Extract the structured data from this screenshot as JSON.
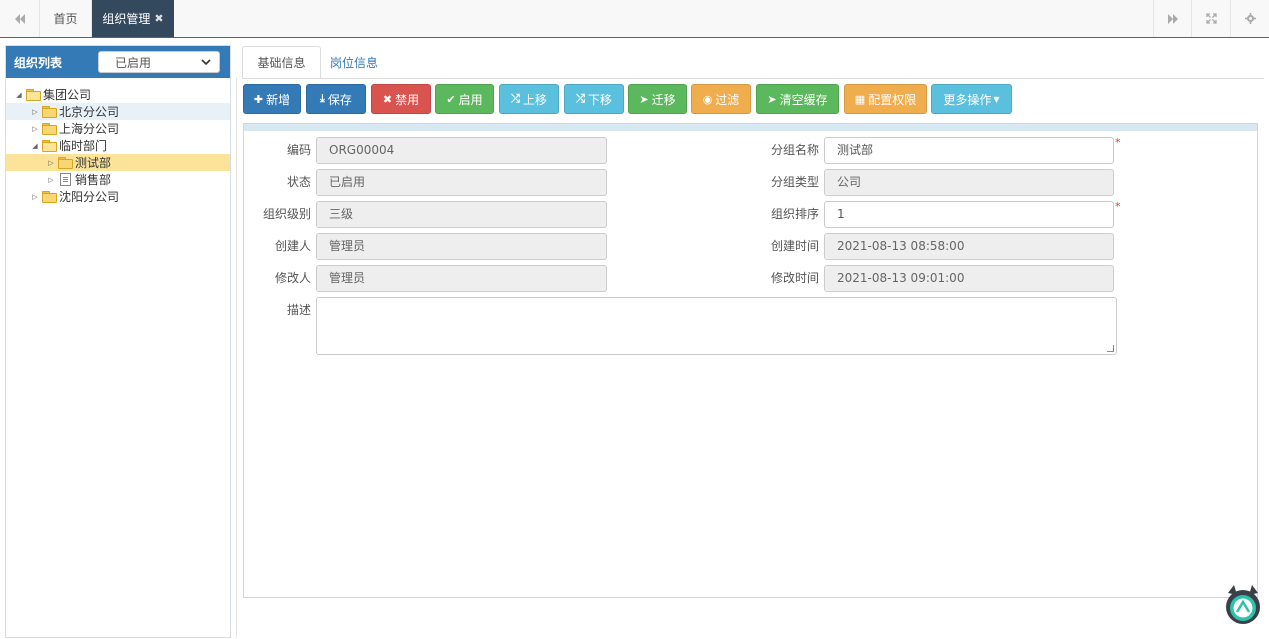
{
  "topbar": {
    "home_tab": "首页",
    "active_tab": "组织管理",
    "close_glyph": "✖",
    "nav_left_icon": "double-chevron-left-icon",
    "nav_right_icon": "double-chevron-right-icon",
    "fullscreen_icon": "fullscreen-icon",
    "settings_icon": "gear-icon"
  },
  "left_panel": {
    "title": "组织列表",
    "status_select_value": "已启用",
    "tree": [
      {
        "label": "集团公司",
        "level": 0,
        "expanded": true,
        "type": "folder"
      },
      {
        "label": "北京分公司",
        "level": 1,
        "expanded": false,
        "type": "folder",
        "highlight": true
      },
      {
        "label": "上海分公司",
        "level": 1,
        "expanded": false,
        "type": "folder"
      },
      {
        "label": "临时部门",
        "level": 1,
        "expanded": true,
        "type": "folder"
      },
      {
        "label": "测试部",
        "level": 2,
        "expanded": false,
        "type": "folder",
        "selected": true
      },
      {
        "label": "销售部",
        "level": 2,
        "expanded": false,
        "type": "document"
      },
      {
        "label": "沈阳分公司",
        "level": 1,
        "expanded": false,
        "type": "folder"
      }
    ]
  },
  "tabs": {
    "basic": "基础信息",
    "position": "岗位信息"
  },
  "toolbar": {
    "add": "新增",
    "save": "保存",
    "disable": "禁用",
    "enable": "启用",
    "move_up": "上移",
    "move_down": "下移",
    "migrate": "迁移",
    "filter": "过滤",
    "clear_cache": "清空缓存",
    "config_perm": "配置权限",
    "more": "更多操作"
  },
  "colors": {
    "primary": "#337ab7",
    "danger": "#d9534f",
    "success": "#5cb85c",
    "info": "#5bc0de",
    "warning": "#f0ad4e"
  },
  "form": {
    "code_label": "编码",
    "code_value": "ORG00004",
    "status_label": "状态",
    "status_value": "已启用",
    "level_label": "组织级别",
    "level_value": "三级",
    "creator_label": "创建人",
    "creator_value": "管理员",
    "modifier_label": "修改人",
    "modifier_value": "管理员",
    "desc_label": "描述",
    "desc_value": "",
    "group_name_label": "分组名称",
    "group_name_value": "测试部",
    "group_type_label": "分组类型",
    "group_type_value": "公司",
    "order_label": "组织排序",
    "order_value": "1",
    "created_time_label": "创建时间",
    "created_time_value": "2021-08-13 08:58:00",
    "modified_time_label": "修改时间",
    "modified_time_value": "2021-08-13 09:01:00",
    "required_mark": "*"
  }
}
